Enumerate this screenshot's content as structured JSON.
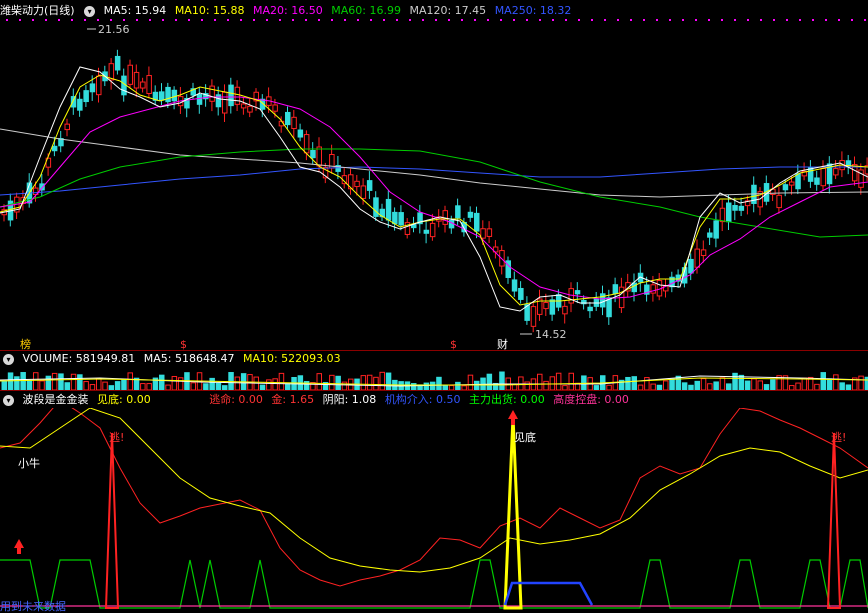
{
  "main": {
    "title": "潍柴动力(日线)",
    "ma": [
      {
        "label": "MA5: 15.94",
        "color": "#ffffff"
      },
      {
        "label": "MA10: 15.88",
        "color": "#ffff00"
      },
      {
        "label": "MA20: 16.50",
        "color": "#ff00ff"
      },
      {
        "label": "MA60: 16.99",
        "color": "#00cc00"
      },
      {
        "label": "MA120: 17.45",
        "color": "#cccccc"
      },
      {
        "label": "MA250: 18.32",
        "color": "#3355ff"
      }
    ],
    "high_label": "21.56",
    "low_label": "14.52",
    "markers": [
      {
        "text": "榜",
        "color": "#ffcc00"
      },
      {
        "text": "$",
        "color": "#ff3333"
      },
      {
        "text": "$",
        "color": "#ff3333"
      },
      {
        "text": "财",
        "color": "#ffffff"
      }
    ]
  },
  "volume": {
    "items": [
      {
        "label": "VOLUME: 581949.81",
        "color": "#ffffff"
      },
      {
        "label": "MA5: 518648.47",
        "color": "#ffffff"
      },
      {
        "label": "MA10: 522093.03",
        "color": "#ffff00"
      }
    ]
  },
  "indicator": {
    "title": "波段是金金装",
    "items": [
      {
        "label": "见底: 0.00",
        "color": "#ffff00"
      },
      {
        "label": "逃命: 0.00",
        "color": "#ff3333"
      },
      {
        "label": "金: 1.65",
        "color": "#ff3333"
      },
      {
        "label": "阴阳: 1.08",
        "color": "#ffffff"
      },
      {
        "label": "机构介入: 0.50",
        "color": "#3355ff"
      },
      {
        "label": "主力出货: 0.00",
        "color": "#00ff00"
      },
      {
        "label": "高度控盘: 0.00",
        "color": "#ff3399"
      }
    ],
    "labels": {
      "escape1": "逃!",
      "escape2": "逃!",
      "bottom": "见底",
      "bull": "小牛"
    },
    "watermark": "用到未来数据"
  }
}
